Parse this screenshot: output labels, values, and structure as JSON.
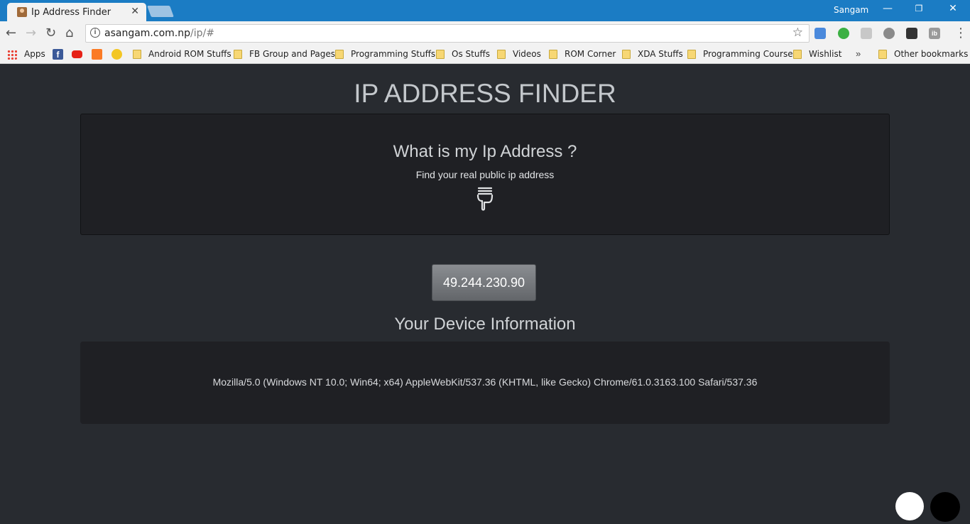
{
  "browser": {
    "tab_title": "Ip Address Finder",
    "tab_close": "✕",
    "profile_name": "Sangam",
    "url_host": "asangam.com.np",
    "url_path": "/ip/#",
    "bookmarks": [
      "Apps",
      "Android ROM Stuffs",
      "FB Group and Pages",
      "Programming Stuffs",
      "Os Stuffs",
      "Videos",
      "ROM Corner",
      "XDA Stuffs",
      "Programming Course",
      "Wishlist"
    ],
    "more_bookmarks": "»",
    "other_bookmarks": "Other bookmarks"
  },
  "page": {
    "title": "IP ADDRESS FINDER",
    "heading": "What is my Ip Address ?",
    "subheading": "Find your real public ip address",
    "ip_address": "49.244.230.90",
    "device_heading": "Your Device Information",
    "user_agent": "Mozilla/5.0 (Windows NT 10.0; Win64; x64) AppleWebKit/537.36 (KHTML, like Gecko) Chrome/61.0.3163.100 Safari/537.36"
  },
  "colors": {
    "page_background": "#282b30",
    "card_background": "#1f2024",
    "titlebar": "#1b7cc4"
  }
}
